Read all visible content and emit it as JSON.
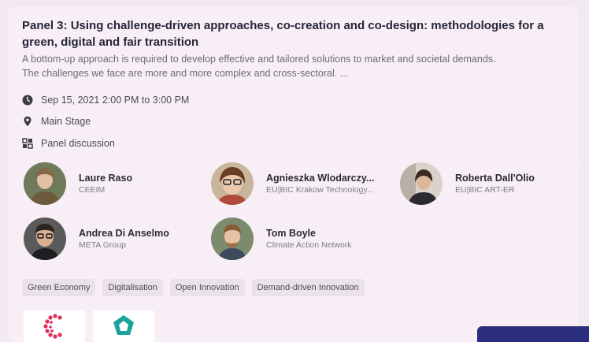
{
  "event": {
    "title": "Panel 3: Using challenge-driven approaches, co-creation and co-design: methodologies for a green, digital and fair transition",
    "description": "A bottom-up approach is required to develop effective and tailored solutions to market and societal demands. The challenges we face are more and more complex and cross-sectoral. ...",
    "datetime": "Sep 15, 2021 2:00 PM to 3:00 PM",
    "location": "Main Stage",
    "format": "Panel discussion"
  },
  "speakers": [
    {
      "name": "Laure Raso",
      "org": "CEEIM"
    },
    {
      "name": "Agnieszka Wlodarczy...",
      "org": "EU|BIC Krakow Technology..."
    },
    {
      "name": "Roberta Dall'Olio",
      "org": "EU|BIC ART-ER"
    },
    {
      "name": "Andrea Di Anselmo",
      "org": "META Group"
    },
    {
      "name": "Tom Boyle",
      "org": "Climate Action Network"
    }
  ],
  "tags": [
    "Green Economy",
    "Digitalisation",
    "Open Innovation",
    "Demand-driven Innovation"
  ],
  "icons": {
    "datetime": "clock-icon",
    "location": "location-pin-icon",
    "format": "grid-icon"
  },
  "colors": {
    "background": "#f8eff6",
    "title": "#242638",
    "accent": "#2a2e7c",
    "tag_bg": "#ebe2e9"
  }
}
